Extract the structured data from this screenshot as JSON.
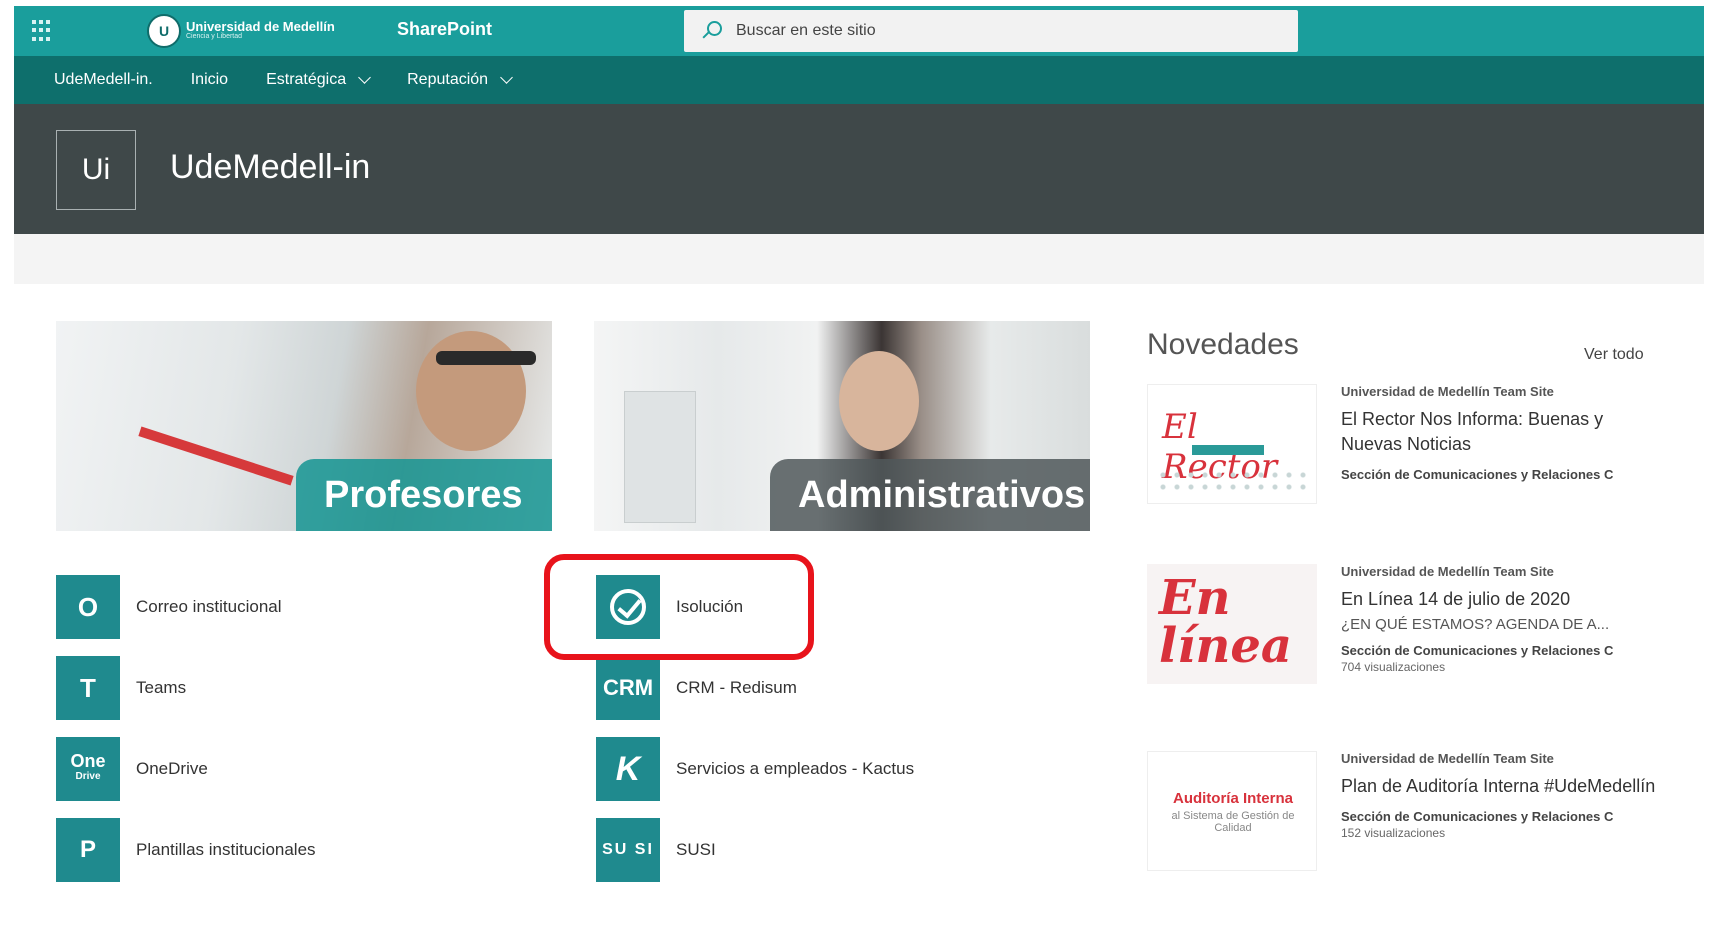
{
  "suitebar": {
    "logo_name": "Universidad de Medellín",
    "logo_tagline": "Ciencia y Libertad",
    "product": "SharePoint",
    "search_placeholder": "Buscar en este sitio"
  },
  "hubnav": {
    "items": [
      {
        "label": "UdeMedell-in."
      },
      {
        "label": "Inicio"
      },
      {
        "label": "Estratégica"
      },
      {
        "label": "Reputación"
      }
    ]
  },
  "site": {
    "logo_initials": "Ui",
    "title": "UdeMedell-in"
  },
  "tiles": [
    {
      "label": "Profesores"
    },
    {
      "label": "Administrativos"
    }
  ],
  "links_left": [
    {
      "label": "Correo institucional",
      "icon": "outlook-icon",
      "glyph": "O"
    },
    {
      "label": "Teams",
      "icon": "teams-icon",
      "glyph": "T"
    },
    {
      "label": "OneDrive",
      "icon": "onedrive-icon",
      "glyph": "One",
      "glyph2": "Drive"
    },
    {
      "label": "Plantillas institucionales",
      "icon": "powerpoint-icon",
      "glyph": "P"
    }
  ],
  "links_right": [
    {
      "label": "Isolución",
      "icon": "isolucion-icon"
    },
    {
      "label": "CRM - Redisum",
      "icon": "crm-icon",
      "glyph": "CRM"
    },
    {
      "label": "Servicios a empleados - Kactus",
      "icon": "kactus-icon",
      "glyph": "K"
    },
    {
      "label": "SUSI",
      "icon": "susi-icon",
      "glyph": "SU SI"
    }
  ],
  "news": {
    "title": "Novedades",
    "see_all": "Ver todo",
    "items": [
      {
        "site": "Universidad de Medellín Team Site",
        "title": "El Rector Nos Informa: Buenas y Nuevas Noticias",
        "description": "",
        "author": "Sección de Comunicaciones y Relaciones C",
        "views": "",
        "thumb_text": "El Rector"
      },
      {
        "site": "Universidad de Medellín Team Site",
        "title": "En Línea 14 de julio de 2020",
        "description": "¿EN QUÉ ESTAMOS? AGENDA DE A...",
        "author": "Sección de Comunicaciones y Relaciones C",
        "views": "704 visualizaciones",
        "thumb_text": "En línea"
      },
      {
        "site": "Universidad de Medellín Team Site",
        "title": "Plan de Auditoría Interna #UdeMedellín",
        "description": "",
        "author": "Sección de Comunicaciones y Relaciones C",
        "views": "152 visualizaciones",
        "thumb_text": "Auditoría Interna",
        "thumb_sub": "al Sistema de Gestión de Calidad"
      }
    ]
  },
  "colors": {
    "suitebar": "#1a9e9c",
    "hubnav": "#0e6f6c",
    "site_header": "#3f4849",
    "highlight": "#e8131b"
  }
}
